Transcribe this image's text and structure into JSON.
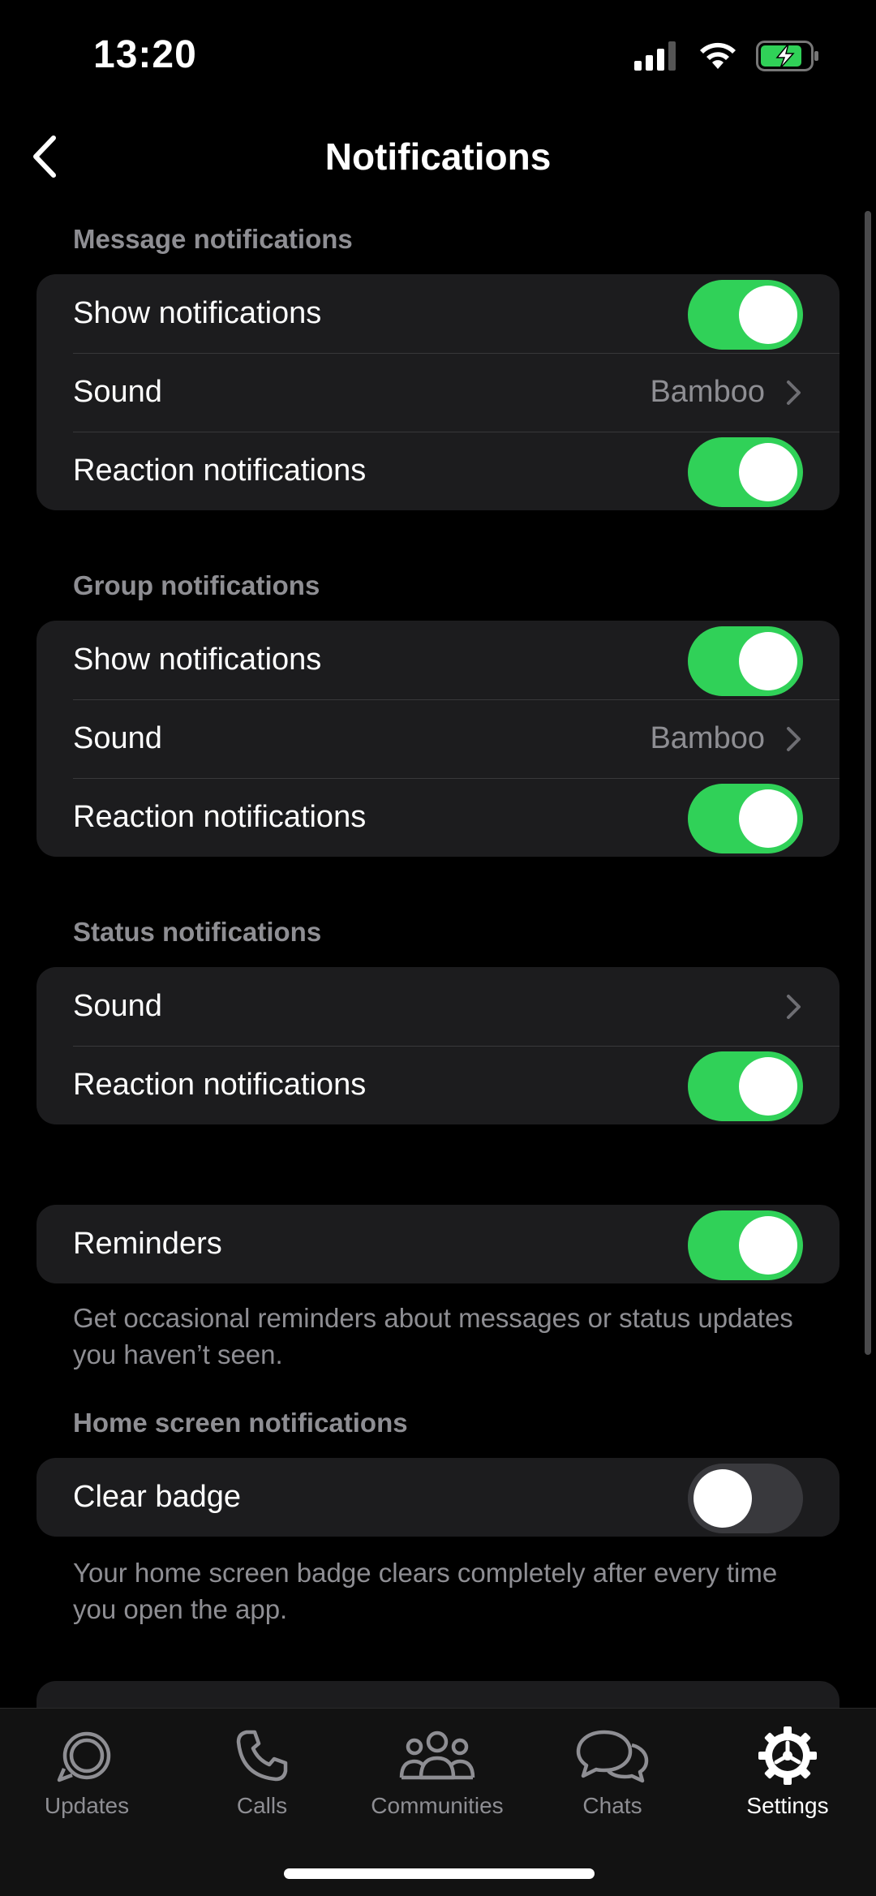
{
  "status_bar": {
    "time": "13:20"
  },
  "nav": {
    "title": "Notifications"
  },
  "message_notifications": {
    "header": "Message notifications",
    "rows": [
      {
        "label": "Show notifications",
        "toggle": true
      },
      {
        "label": "Sound",
        "value": "Bamboo"
      },
      {
        "label": "Reaction notifications",
        "toggle": true
      }
    ]
  },
  "group_notifications": {
    "header": "Group notifications",
    "rows": [
      {
        "label": "Show notifications",
        "toggle": true
      },
      {
        "label": "Sound",
        "value": "Bamboo"
      },
      {
        "label": "Reaction notifications",
        "toggle": true
      }
    ]
  },
  "status_notifications": {
    "header": "Status notifications",
    "rows": [
      {
        "label": "Sound"
      },
      {
        "label": "Reaction notifications",
        "toggle": true
      }
    ]
  },
  "reminders": {
    "label": "Reminders",
    "toggle": true,
    "footnote": "Get occasional reminders about messages or status updates you haven’t seen."
  },
  "home_screen": {
    "header": "Home screen notifications",
    "label": "Clear badge",
    "toggle": false,
    "footnote": "Your home screen badge clears completely after every time you open the app."
  },
  "tabbar": {
    "tabs": [
      {
        "label": "Updates",
        "icon": "updates-icon",
        "active": false
      },
      {
        "label": "Calls",
        "icon": "phone-icon",
        "active": false
      },
      {
        "label": "Communities",
        "icon": "communities-icon",
        "active": false
      },
      {
        "label": "Chats",
        "icon": "chats-icon",
        "active": false
      },
      {
        "label": "Settings",
        "icon": "gear-icon",
        "active": true
      }
    ]
  },
  "colors": {
    "toggle_on": "#30d158",
    "cell_background": "#1c1c1e",
    "secondary_text": "#8e8e93"
  }
}
